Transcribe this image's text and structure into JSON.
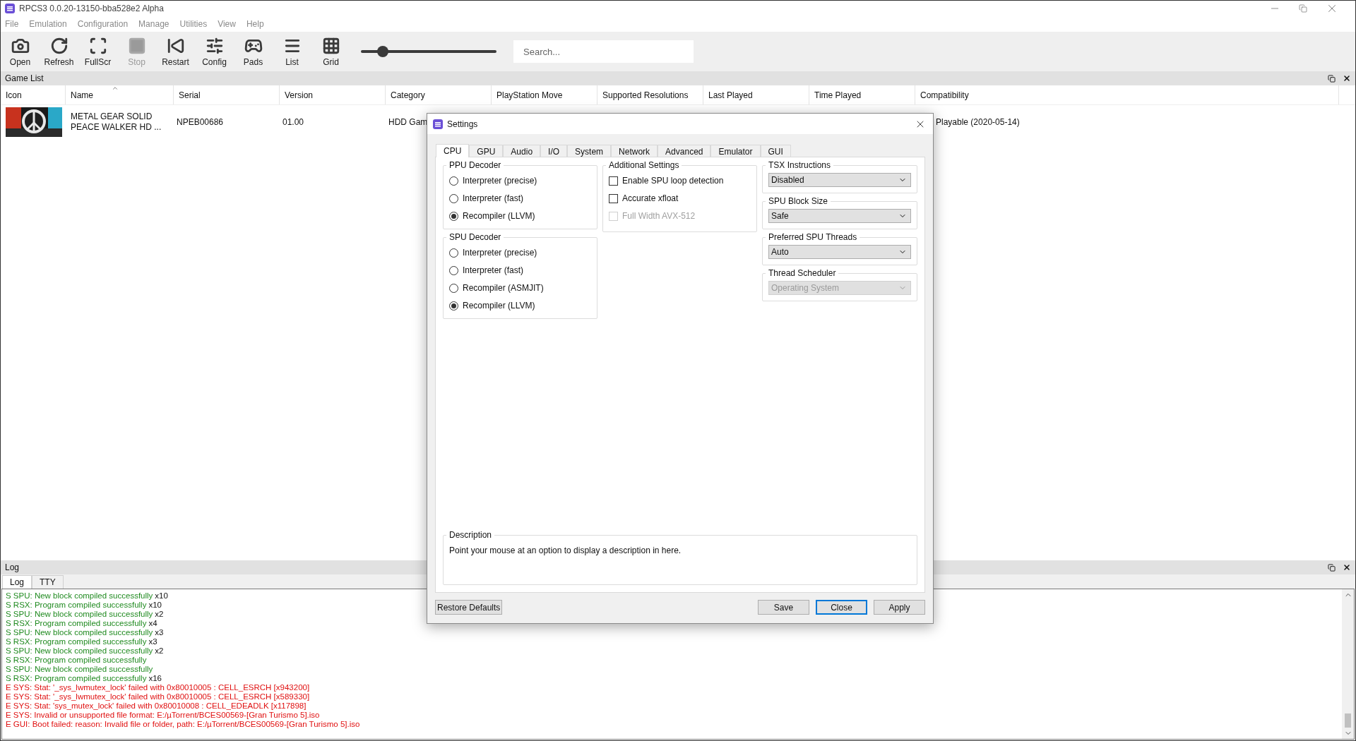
{
  "window": {
    "title": "RPCS3 0.0.20-13150-bba528e2 Alpha"
  },
  "menu": [
    "File",
    "Emulation",
    "Configuration",
    "Manage",
    "Utilities",
    "View",
    "Help"
  ],
  "toolbar": {
    "buttons": [
      {
        "kind": "open",
        "label": "Open",
        "disabled": false
      },
      {
        "kind": "refresh",
        "label": "Refresh",
        "disabled": false
      },
      {
        "kind": "fullscreen",
        "label": "FullScr",
        "disabled": false
      },
      {
        "kind": "stop",
        "label": "Stop",
        "disabled": true
      },
      {
        "kind": "restart",
        "label": "Restart",
        "disabled": false
      },
      {
        "kind": "config",
        "label": "Config",
        "disabled": false
      },
      {
        "kind": "pads",
        "label": "Pads",
        "disabled": false
      },
      {
        "kind": "list",
        "label": "List",
        "disabled": false
      },
      {
        "kind": "grid",
        "label": "Grid",
        "disabled": false
      }
    ],
    "zoom_slider": {
      "level": 0.16
    },
    "search": {
      "placeholder": "Search..."
    }
  },
  "game_list": {
    "title": "Game List",
    "columns": [
      {
        "label": "Icon",
        "sorted": false
      },
      {
        "label": "Name",
        "sorted": true
      },
      {
        "label": "Serial",
        "sorted": false
      },
      {
        "label": "Version",
        "sorted": false
      },
      {
        "label": "Category",
        "sorted": false
      },
      {
        "label": "PlayStation Move",
        "sorted": false
      },
      {
        "label": "Supported Resolutions",
        "sorted": false
      },
      {
        "label": "Last Played",
        "sorted": false
      },
      {
        "label": "Time Played",
        "sorted": false
      },
      {
        "label": "Compatibility",
        "sorted": false
      }
    ],
    "rows": [
      {
        "icon": {
          "kind": "picture"
        },
        "name": [
          "METAL GEAR SOLID",
          "PEACE WALKER HD ..."
        ],
        "serial": "NPEB00686",
        "version": "01.00",
        "category": "HDD Gam",
        "compatibility": "Playable (2020-05-14)"
      }
    ]
  },
  "settings_dialog": {
    "title": "Settings",
    "tabs": [
      {
        "label": "CPU",
        "selected": true
      },
      {
        "label": "GPU",
        "selected": false
      },
      {
        "label": "Audio",
        "selected": false
      },
      {
        "label": "I/O",
        "selected": false
      },
      {
        "label": "System",
        "selected": false
      },
      {
        "label": "Network",
        "selected": false
      },
      {
        "label": "Advanced",
        "selected": false
      },
      {
        "label": "Emulator",
        "selected": false
      },
      {
        "label": "GUI",
        "selected": false
      }
    ],
    "ppu_decoder": {
      "title": "PPU Decoder",
      "options": [
        {
          "label": "Interpreter (precise)",
          "selected": false
        },
        {
          "label": "Interpreter (fast)",
          "selected": false
        },
        {
          "label": "Recompiler (LLVM)",
          "selected": true
        }
      ]
    },
    "spu_decoder": {
      "title": "SPU Decoder",
      "options": [
        {
          "label": "Interpreter (precise)",
          "selected": false
        },
        {
          "label": "Interpreter (fast)",
          "selected": false
        },
        {
          "label": "Recompiler (ASMJIT)",
          "selected": false
        },
        {
          "label": "Recompiler (LLVM)",
          "selected": true
        }
      ]
    },
    "additional_settings": {
      "title": "Additional Settings",
      "options": [
        {
          "label": "Enable SPU loop detection",
          "checked": false,
          "disabled": false
        },
        {
          "label": "Accurate xfloat",
          "checked": false,
          "disabled": false
        },
        {
          "label": "Full Width AVX-512",
          "checked": false,
          "disabled": true
        }
      ]
    },
    "dropdowns": [
      {
        "title": "TSX Instructions",
        "value": "Disabled",
        "disabled": false
      },
      {
        "title": "SPU Block Size",
        "value": "Safe",
        "disabled": false
      },
      {
        "title": "Preferred SPU Threads",
        "value": "Auto",
        "disabled": false
      },
      {
        "title": "Thread Scheduler",
        "value": "Operating System",
        "disabled": true
      }
    ],
    "description": {
      "title": "Description",
      "text": "Point your mouse at an option to display a description in here."
    },
    "restore_button": "Restore Defaults",
    "buttons": [
      {
        "label": "Save",
        "default": false
      },
      {
        "label": "Close",
        "default": true
      },
      {
        "label": "Apply",
        "default": false
      }
    ]
  },
  "log": {
    "title": "Log",
    "tabs": [
      {
        "label": "Log",
        "selected": true
      },
      {
        "label": "TTY",
        "selected": false
      }
    ],
    "lines": [
      {
        "kind": "success",
        "text": "S SPU: New block compiled successfully",
        "count": "x10"
      },
      {
        "kind": "success",
        "text": "S RSX: Program compiled successfully",
        "count": "x10"
      },
      {
        "kind": "success",
        "text": "S SPU: New block compiled successfully",
        "count": "x2"
      },
      {
        "kind": "success",
        "text": "S RSX: Program compiled successfully",
        "count": "x4"
      },
      {
        "kind": "success",
        "text": "S SPU: New block compiled successfully",
        "count": "x3"
      },
      {
        "kind": "success",
        "text": "S RSX: Program compiled successfully",
        "count": "x3"
      },
      {
        "kind": "success",
        "text": "S SPU: New block compiled successfully",
        "count": "x2"
      },
      {
        "kind": "success",
        "text": "S RSX: Program compiled successfully"
      },
      {
        "kind": "success",
        "text": "S SPU: New block compiled successfully"
      },
      {
        "kind": "success",
        "text": "S RSX: Program compiled successfully",
        "count": "x16"
      },
      {
        "kind": "error",
        "text": "E SYS: Stat: '_sys_lwmutex_lock' failed with 0x80010005 : CELL_ESRCH [x943200]"
      },
      {
        "kind": "error",
        "text": "E SYS: Stat: '_sys_lwmutex_lock' failed with 0x80010005 : CELL_ESRCH [x589330]"
      },
      {
        "kind": "error",
        "text": "E SYS: Stat: 'sys_mutex_lock' failed with 0x80010008 : CELL_EDEADLK [x117898]"
      },
      {
        "kind": "error",
        "text": "E SYS: Invalid or unsupported file format: E:/µTorrent/BCES00569-[Gran Turismo 5].iso"
      },
      {
        "kind": "error",
        "text": "E GUI: Boot failed: reason: Invalid file or folder, path: E:/µTorrent/BCES00569-[Gran Turismo 5].iso"
      }
    ]
  }
}
